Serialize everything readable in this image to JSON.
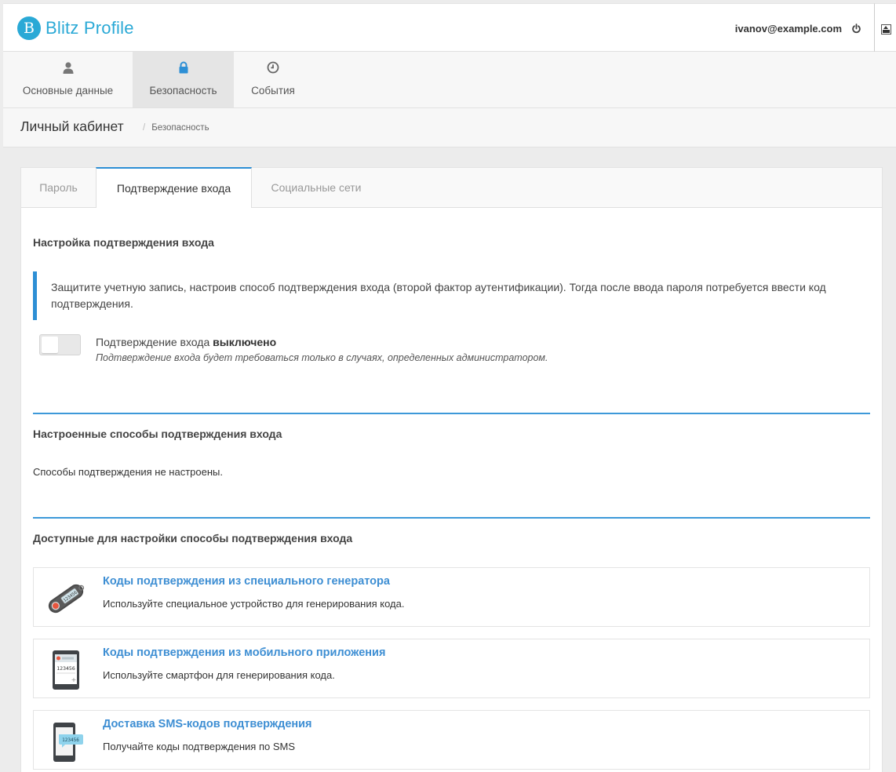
{
  "header": {
    "brand_letter": "B",
    "brand_name": "Blitz Profile",
    "user_email": "ivanov@example.com",
    "brand_color": "#2aa9d6"
  },
  "nav": {
    "items": [
      {
        "label": "Основные данные",
        "icon": "user-icon"
      },
      {
        "label": "Безопасность",
        "icon": "lock-icon",
        "active": true
      },
      {
        "label": "События",
        "icon": "clock-icon"
      }
    ]
  },
  "page": {
    "title": "Личный кабинет",
    "breadcrumb_sep": "/",
    "breadcrumb": "Безопасность"
  },
  "tabs": [
    {
      "label": "Пароль"
    },
    {
      "label": "Подтверждение входа",
      "active": true
    },
    {
      "label": "Социальные сети"
    }
  ],
  "setup": {
    "title": "Настройка подтверждения входа",
    "callout": "Защитите учетную запись, настроив способ подтверждения входа (второй фактор аутентификации). Тогда после ввода пароля потребуется ввести код подтверждения.",
    "toggle_label": "Подтверждение входа",
    "toggle_state": "выключено",
    "toggle_hint": "Подтверждение входа будет требоваться только в случаях, определенных администратором."
  },
  "configured": {
    "title": "Настроенные способы подтверждения входа",
    "empty_text": "Способы подтверждения не настроены."
  },
  "available": {
    "title": "Доступные для настройки способы подтверждения входа",
    "methods": [
      {
        "title": "Коды подтверждения из специального генератора",
        "desc": "Используйте специальное устройство для генерирования кода.",
        "icon": "hardware-token-icon",
        "icon_code": "123456"
      },
      {
        "title": "Коды подтверждения из мобильного приложения",
        "desc": "Используйте смартфон для генерирования кода.",
        "icon": "authenticator-app-icon",
        "icon_code": "123456"
      },
      {
        "title": "Доставка SMS-кодов подтверждения",
        "desc": "Получайте коды подтверждения по SMS",
        "icon": "sms-phone-icon",
        "icon_code": "123456"
      }
    ]
  },
  "colors": {
    "accent": "#2d8fd5",
    "link": "#3d8ed3"
  }
}
